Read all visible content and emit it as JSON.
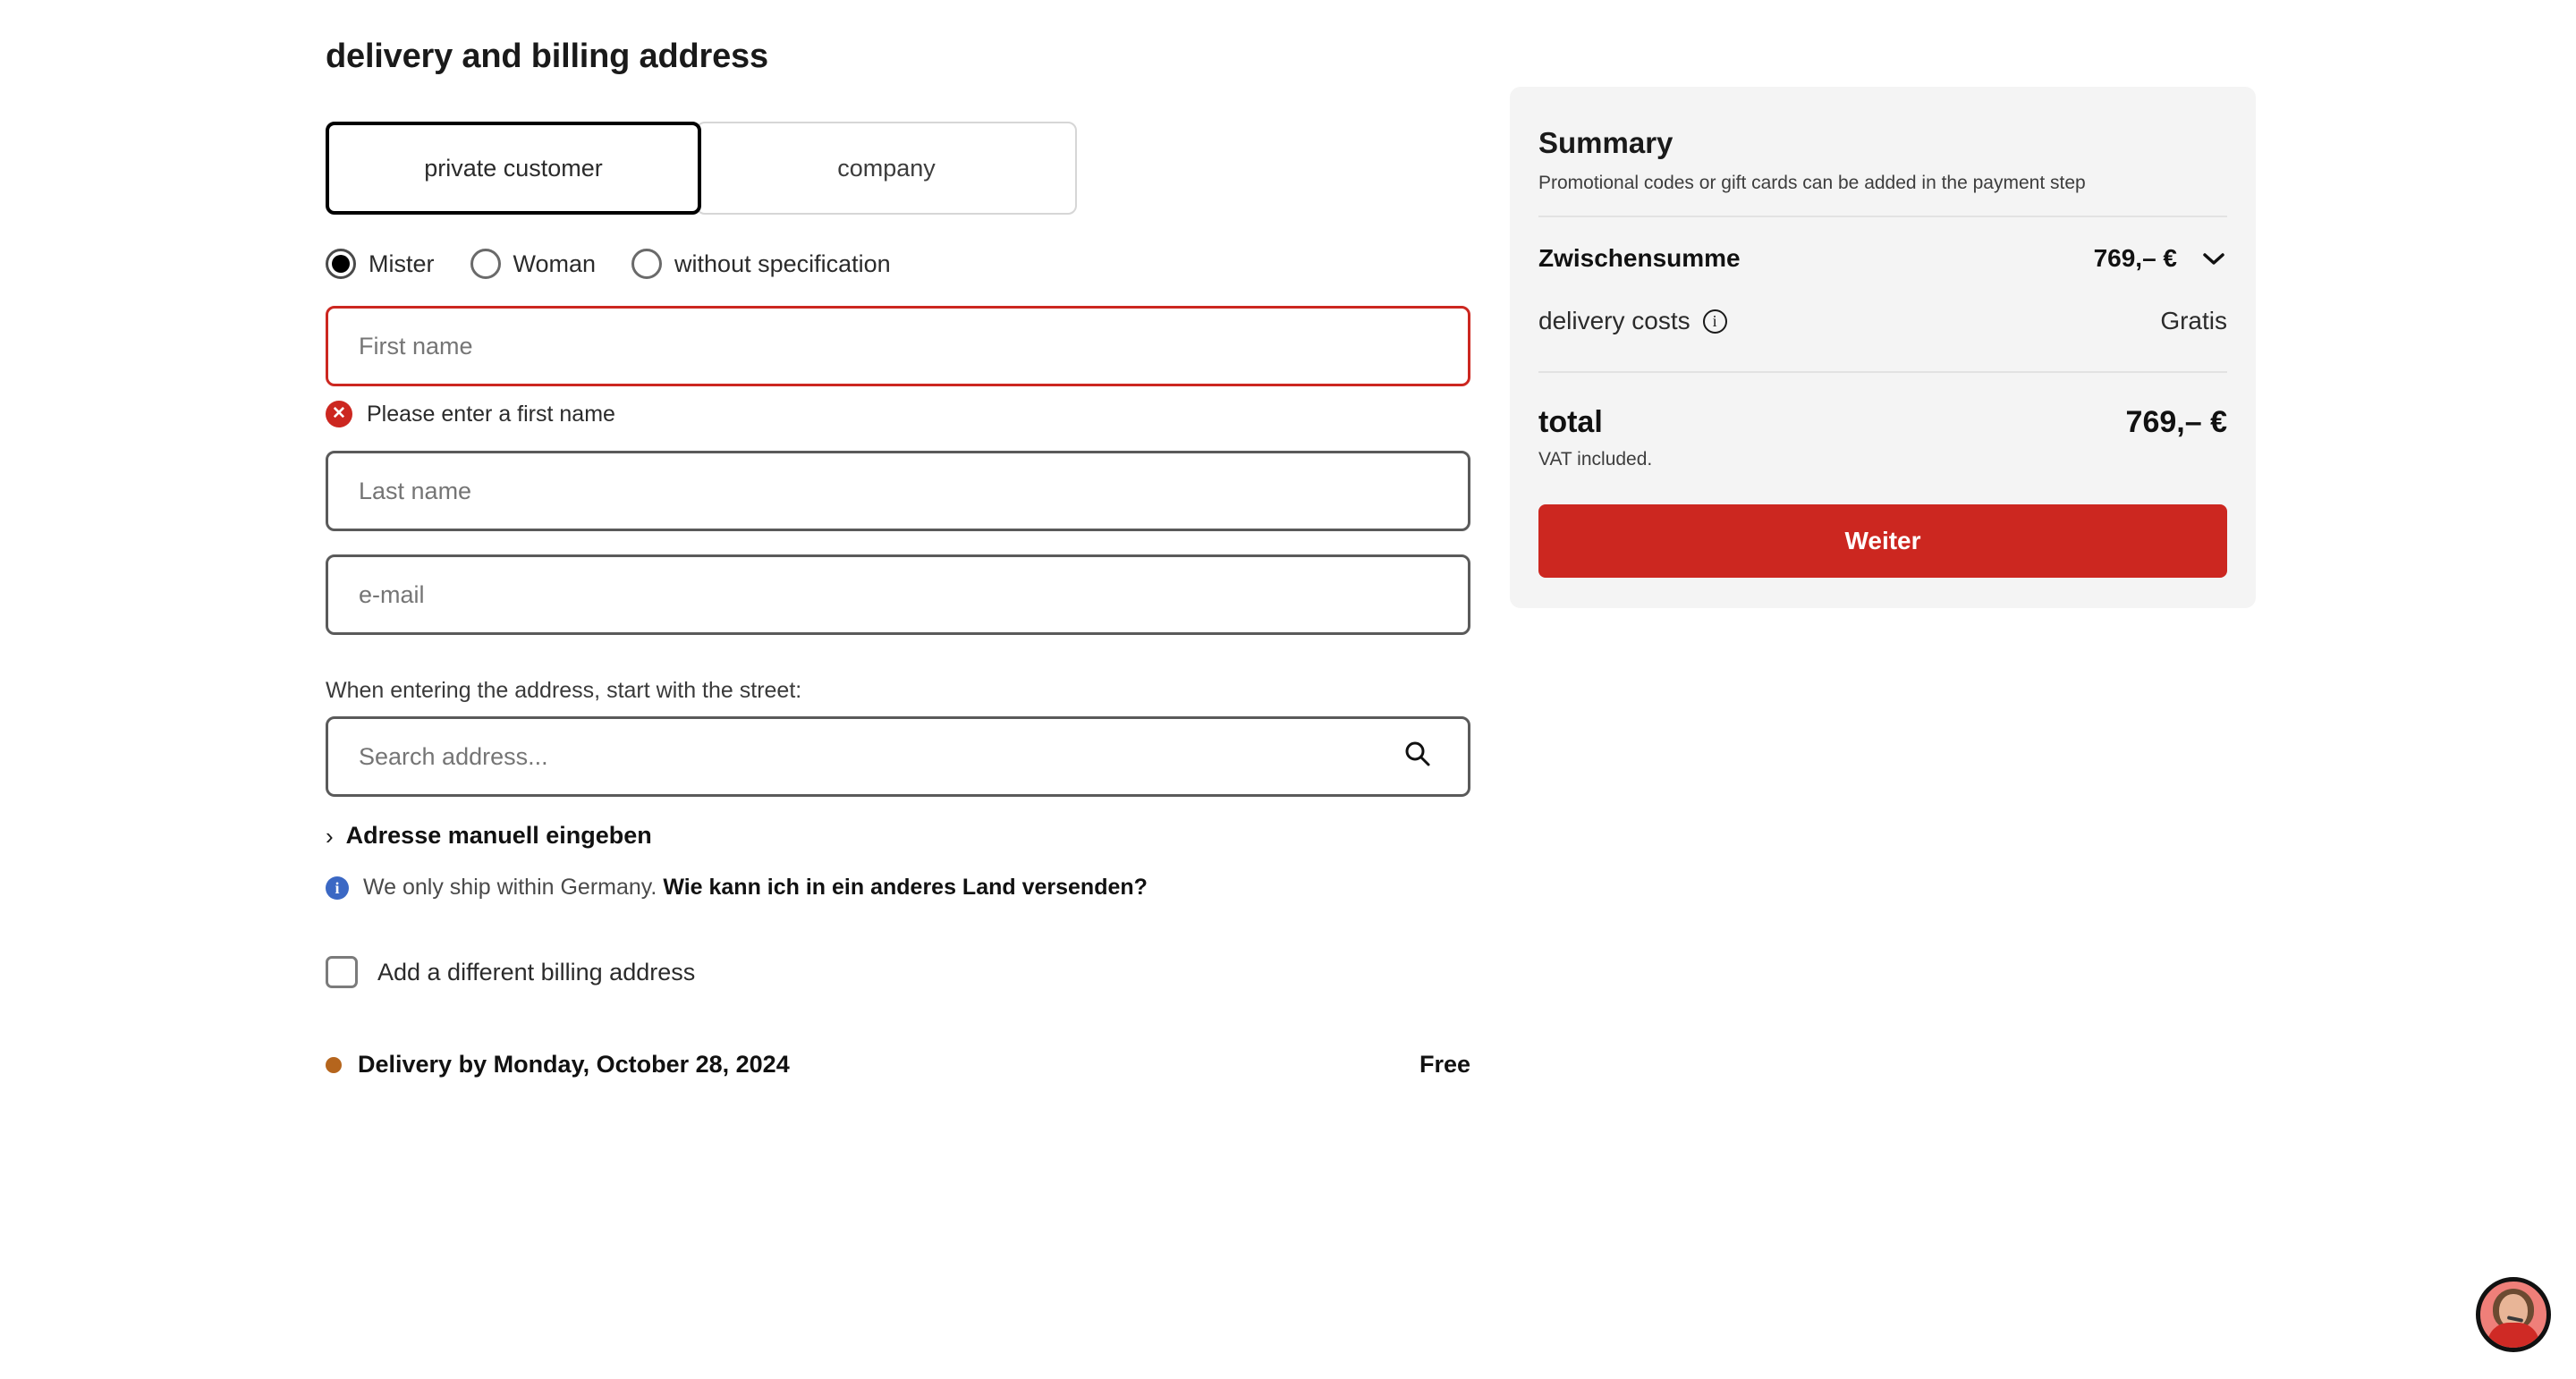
{
  "form": {
    "title": "delivery and billing address",
    "customer_type": {
      "options": [
        {
          "label": "private customer",
          "selected": true
        },
        {
          "label": "company",
          "selected": false
        }
      ]
    },
    "salutation": {
      "options": [
        {
          "label": "Mister",
          "selected": true
        },
        {
          "label": "Woman",
          "selected": false
        },
        {
          "label": "without specification",
          "selected": false
        }
      ]
    },
    "first_name": {
      "placeholder": "First name",
      "value": "",
      "error": "Please enter a first name",
      "error_icon": "error-circle-icon"
    },
    "last_name": {
      "placeholder": "Last name",
      "value": ""
    },
    "email": {
      "placeholder": "e-mail",
      "value": ""
    },
    "address_hint": "When entering the address, start with the street:",
    "address_search": {
      "placeholder": "Search address...",
      "value": "",
      "icon": "search-icon"
    },
    "manual_address_link": "Adresse manuell eingeben",
    "manual_address_chevron": "chevron-right-icon",
    "ship_note": {
      "icon": "info-circle-filled-icon",
      "text": "We only ship within Germany.",
      "link": "Wie kann ich in ein anderes Land versenden?"
    },
    "billing_checkbox": {
      "label": "Add a different billing address",
      "checked": false
    },
    "delivery": {
      "status_dot": "status-dot-icon",
      "text": "Delivery by Monday, October 28, 2024",
      "price": "Free"
    }
  },
  "summary": {
    "title": "Summary",
    "subtitle": "Promotional codes or gift cards can be added in the payment step",
    "subtotal": {
      "label": "Zwischensumme",
      "value": "769,– €",
      "chevron": "chevron-down-icon"
    },
    "delivery_costs": {
      "label": "delivery costs",
      "info_icon": "info-circle-outline-icon",
      "value": "Gratis"
    },
    "total": {
      "label": "total",
      "value": "769,– €",
      "note": "VAT included."
    },
    "cta_label": "Weiter"
  },
  "support_widget": {
    "name": "support-agent-avatar"
  },
  "colors": {
    "accent_red": "#cc2720",
    "error_red": "#cc2720",
    "info_blue": "#3b68c4",
    "delivery_dot": "#b5651d",
    "card_bg": "#f4f4f4"
  }
}
